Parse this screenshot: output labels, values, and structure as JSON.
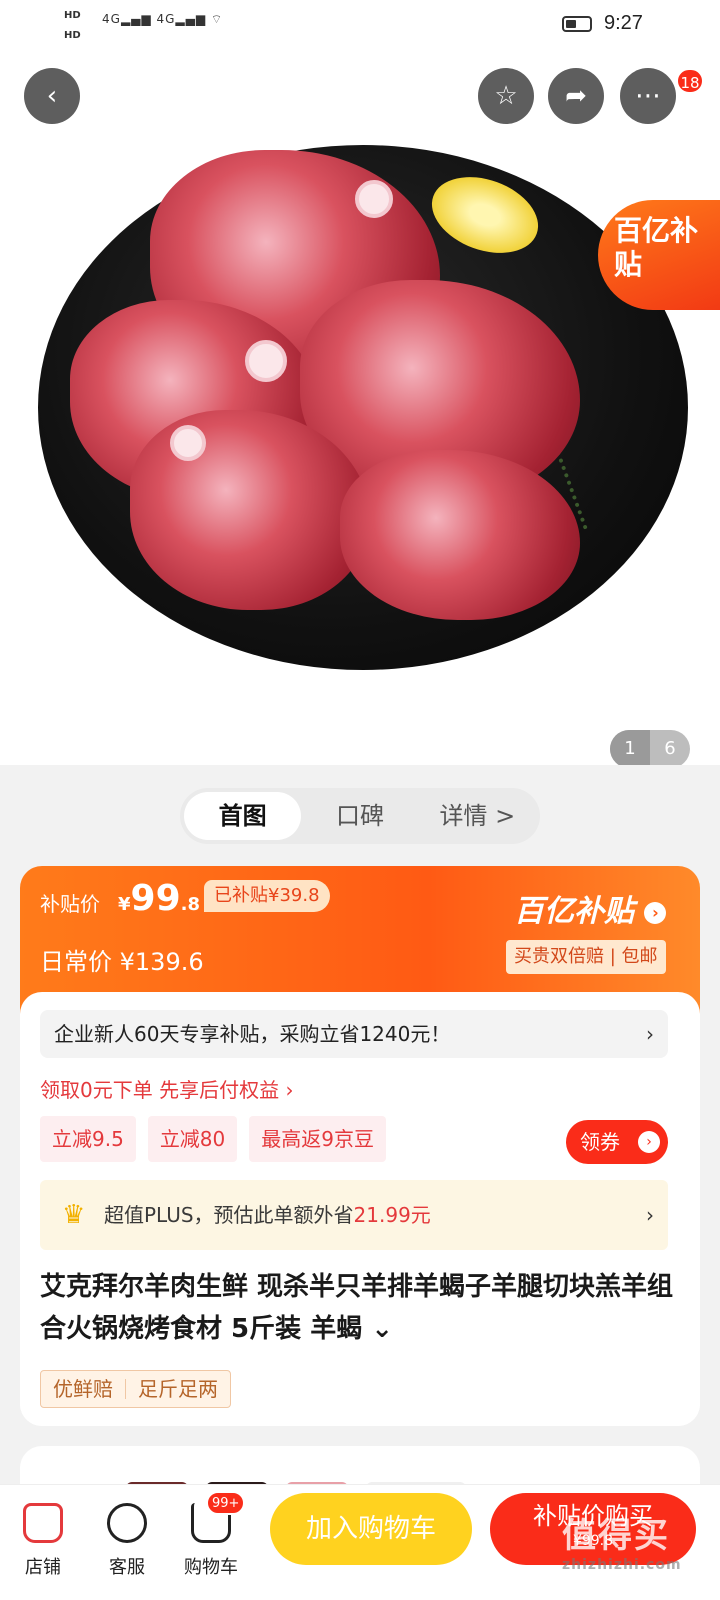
{
  "status_bar": {
    "time": "9:27",
    "network": "4G",
    "hd_label": "HD"
  },
  "hero": {
    "page_current": "1",
    "page_total": "6",
    "subsidy_tag": "百亿补贴"
  },
  "header": {
    "more_badge": "18"
  },
  "tabs": [
    "首图",
    "口碑",
    "详情 >"
  ],
  "price": {
    "subsidy_label": "补贴价",
    "currency": "¥",
    "subsidy_price_main": "99",
    "subsidy_price_cents": ".8",
    "subsidized_amount": "已补贴¥39.8",
    "daily_label": "日常价",
    "daily_price": "¥139.6",
    "brand": "百亿补贴",
    "guarantee": "买贵双倍赔 | 包邮"
  },
  "promo": {
    "enterprise": "企业新人60天专享补贴，采购立省1240元！",
    "credit": "领取0元下单 先享后付权益 ›",
    "coupons": [
      "立减9.5",
      "立减80",
      "最高返9京豆"
    ],
    "get_coupon": "领券",
    "plus_prefix": "超值PLUS，预估此单额外省",
    "plus_amount": "21.99元"
  },
  "product": {
    "title": "艾克拜尔羊肉生鲜 现杀半只羊排羊蝎子羊腿切块羔羊组合火锅烧烤食材 5斤装 羊蝎 ⌄",
    "tags": [
      "优鲜赔",
      "足斤足两"
    ]
  },
  "bottom_bar": {
    "store": "店铺",
    "service": "客服",
    "cart": "购物车",
    "cart_badge": "99+",
    "add_to_cart": "加入购物车",
    "buy_now": "补贴价购买",
    "buy_price": "¥99.8"
  },
  "watermark": {
    "main": "值得买",
    "url": "zhizhizhi.com"
  },
  "colors": {
    "accent": "#fa2c19",
    "orange": "#ff5a14",
    "yellow": "#ffd21f"
  }
}
